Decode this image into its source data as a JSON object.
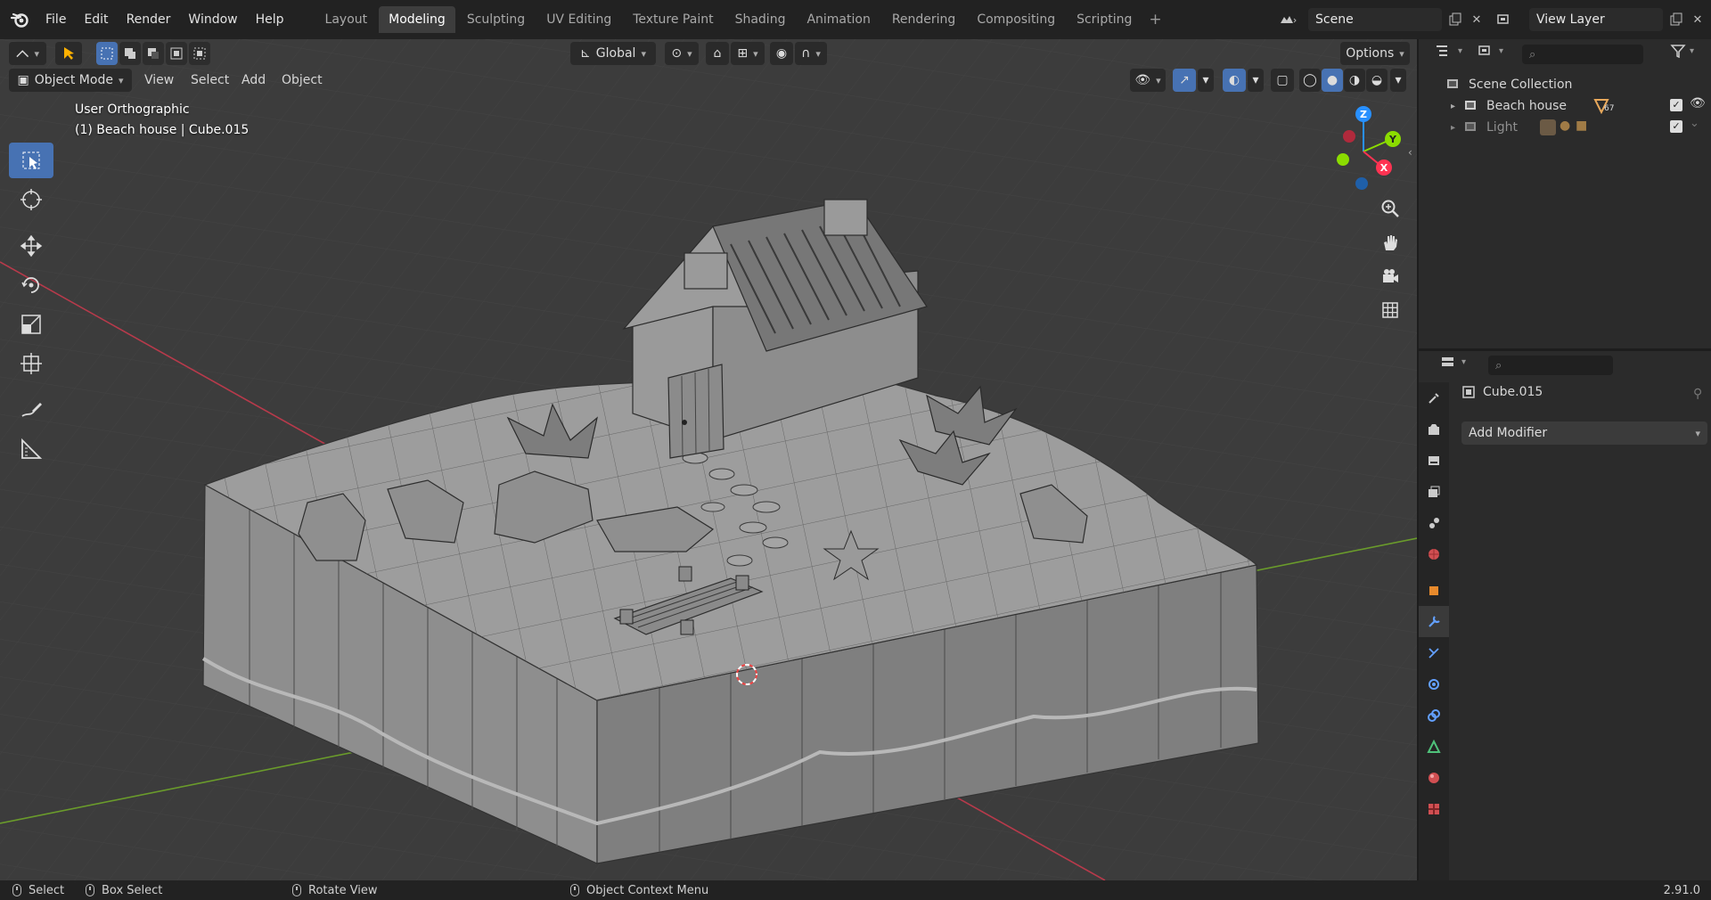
{
  "topbar": {
    "menu": [
      "File",
      "Edit",
      "Render",
      "Window",
      "Help"
    ],
    "workspaces": [
      "Layout",
      "Modeling",
      "Sculpting",
      "UV Editing",
      "Texture Paint",
      "Shading",
      "Animation",
      "Rendering",
      "Compositing",
      "Scripting"
    ],
    "active_workspace": "Modeling",
    "add_symbol": "+",
    "scene_name": "Scene",
    "view_layer_name": "View Layer"
  },
  "viewport_header": {
    "transform_orientation": "Global",
    "options_label": "Options",
    "mode": "Object Mode",
    "menus": [
      "View",
      "Select",
      "Add",
      "Object"
    ]
  },
  "viewport": {
    "view_name": "User Orthographic",
    "object_info": "(1) Beach house | Cube.015",
    "gizmo_axes": [
      "Z",
      "Y",
      "X"
    ],
    "colors": {
      "background": "#3c3c3c",
      "x_axis": "#ff3352",
      "y_axis": "#8bdc00",
      "z_axis": "#2890ff",
      "mesh_face": "#9b9b9b",
      "mesh_edge": "#3a3a3a",
      "selection": "#4772b3"
    }
  },
  "outliner": {
    "root": "Scene Collection",
    "items": [
      {
        "label": "Beach house",
        "badge": "67"
      },
      {
        "label": "Light",
        "badge": ""
      }
    ]
  },
  "properties": {
    "object_name": "Cube.015",
    "add_modifier_label": "Add Modifier",
    "tab_icons": [
      "tool-icon",
      "render-icon",
      "output-icon",
      "view-layer-icon",
      "scene-icon",
      "world-icon",
      "object-icon",
      "modifier-icon",
      "particles-icon",
      "physics-icon",
      "constraints-icon",
      "data-icon",
      "material-icon",
      "texture-icon"
    ]
  },
  "statusbar": {
    "select_label": "Select",
    "box_select_label": "Box Select",
    "rotate_view_label": "Rotate View",
    "context_menu_label": "Object Context Menu",
    "version": "2.91.0"
  }
}
